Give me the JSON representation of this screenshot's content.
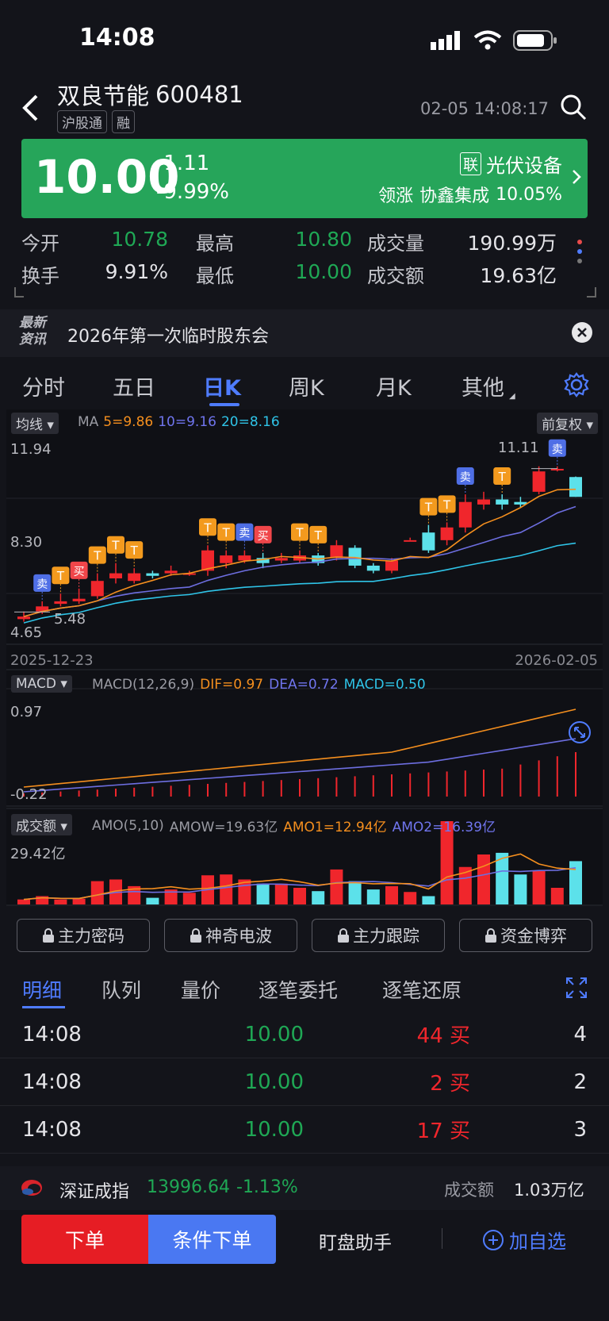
{
  "status": {
    "time": "14:08"
  },
  "header": {
    "name": "双良节能",
    "code": "600481",
    "tag1": "沪股通",
    "tag2": "融",
    "datetime": "02-05 14:08:17"
  },
  "quote": {
    "price": "10.00",
    "change": "-1.11",
    "pct": "-9.99%",
    "sector_badge": "联",
    "sector": "光伏设备",
    "leader_label": "领涨",
    "leader": "协鑫集成",
    "leader_pct": "10.05%"
  },
  "stats": [
    {
      "label": "今开",
      "value": "10.78",
      "color": "green"
    },
    {
      "label": "最高",
      "value": "10.80",
      "color": "green"
    },
    {
      "label": "成交量",
      "value": "190.99万",
      "color": "white"
    },
    {
      "label": "换手",
      "value": "9.91%",
      "color": "white"
    },
    {
      "label": "最低",
      "value": "10.00",
      "color": "green"
    },
    {
      "label": "成交额",
      "value": "19.63亿",
      "color": "white"
    }
  ],
  "news": {
    "logo_top": "最新",
    "logo_bottom": "资讯",
    "text": "2026年第一次临时股东会"
  },
  "period_tabs": [
    "分时",
    "五日",
    "日K",
    "周K",
    "月K",
    "其他"
  ],
  "active_tab": "日K",
  "kline": {
    "indicator_btn": "均线",
    "ma_label": "MA",
    "ma5": "5=9.86",
    "ma10": "10=9.16",
    "ma20": "20=8.16",
    "adjust_btn": "前复权",
    "y_top": "11.94",
    "y_mid": "8.30",
    "y_bottom": "4.65",
    "low_mark": "5.48",
    "high_mark": "11.11",
    "date_start": "2025-12-23",
    "date_end": "2026-02-05"
  },
  "macd": {
    "btn": "MACD",
    "params": "MACD(12,26,9)",
    "dif": "DIF=0.97",
    "dea": "DEA=0.72",
    "macd": "MACD=0.50",
    "y_top": "0.97",
    "y_bottom": "-0.22"
  },
  "amo": {
    "btn": "成交额",
    "params": "AMO(5,10)",
    "amow": "AMOW=19.63亿",
    "amo1": "AMO1=12.94亿",
    "amo2": "AMO2=16.39亿",
    "y_top": "29.42亿"
  },
  "tool_buttons": [
    "主力密码",
    "神奇电波",
    "主力跟踪",
    "资金博弈"
  ],
  "detail_tabs": [
    "明细",
    "队列",
    "量价",
    "逐笔委托",
    "逐笔还原"
  ],
  "trades": [
    {
      "time": "14:08",
      "price": "10.00",
      "vol": "44 买",
      "count": "4"
    },
    {
      "time": "14:08",
      "price": "10.00",
      "vol": "2 买",
      "count": "2"
    },
    {
      "time": "14:08",
      "price": "10.00",
      "vol": "17 买",
      "count": "3"
    }
  ],
  "index_bar": {
    "name": "深证成指",
    "value": "13996.64",
    "pct": "-1.13%",
    "amount_label": "成交额",
    "amount": "1.03万亿"
  },
  "bottom": {
    "order": "下单",
    "cond_order": "条件下单",
    "assistant": "盯盘助手",
    "add": "加自选"
  },
  "colors": {
    "up": "#f0262c",
    "down": "#5ce1ea",
    "green": "#1fa855",
    "accent": "#4f7cff",
    "ma5": "#f58f1e",
    "ma10": "#6d6ee0",
    "ma20": "#2fc4e8"
  }
}
